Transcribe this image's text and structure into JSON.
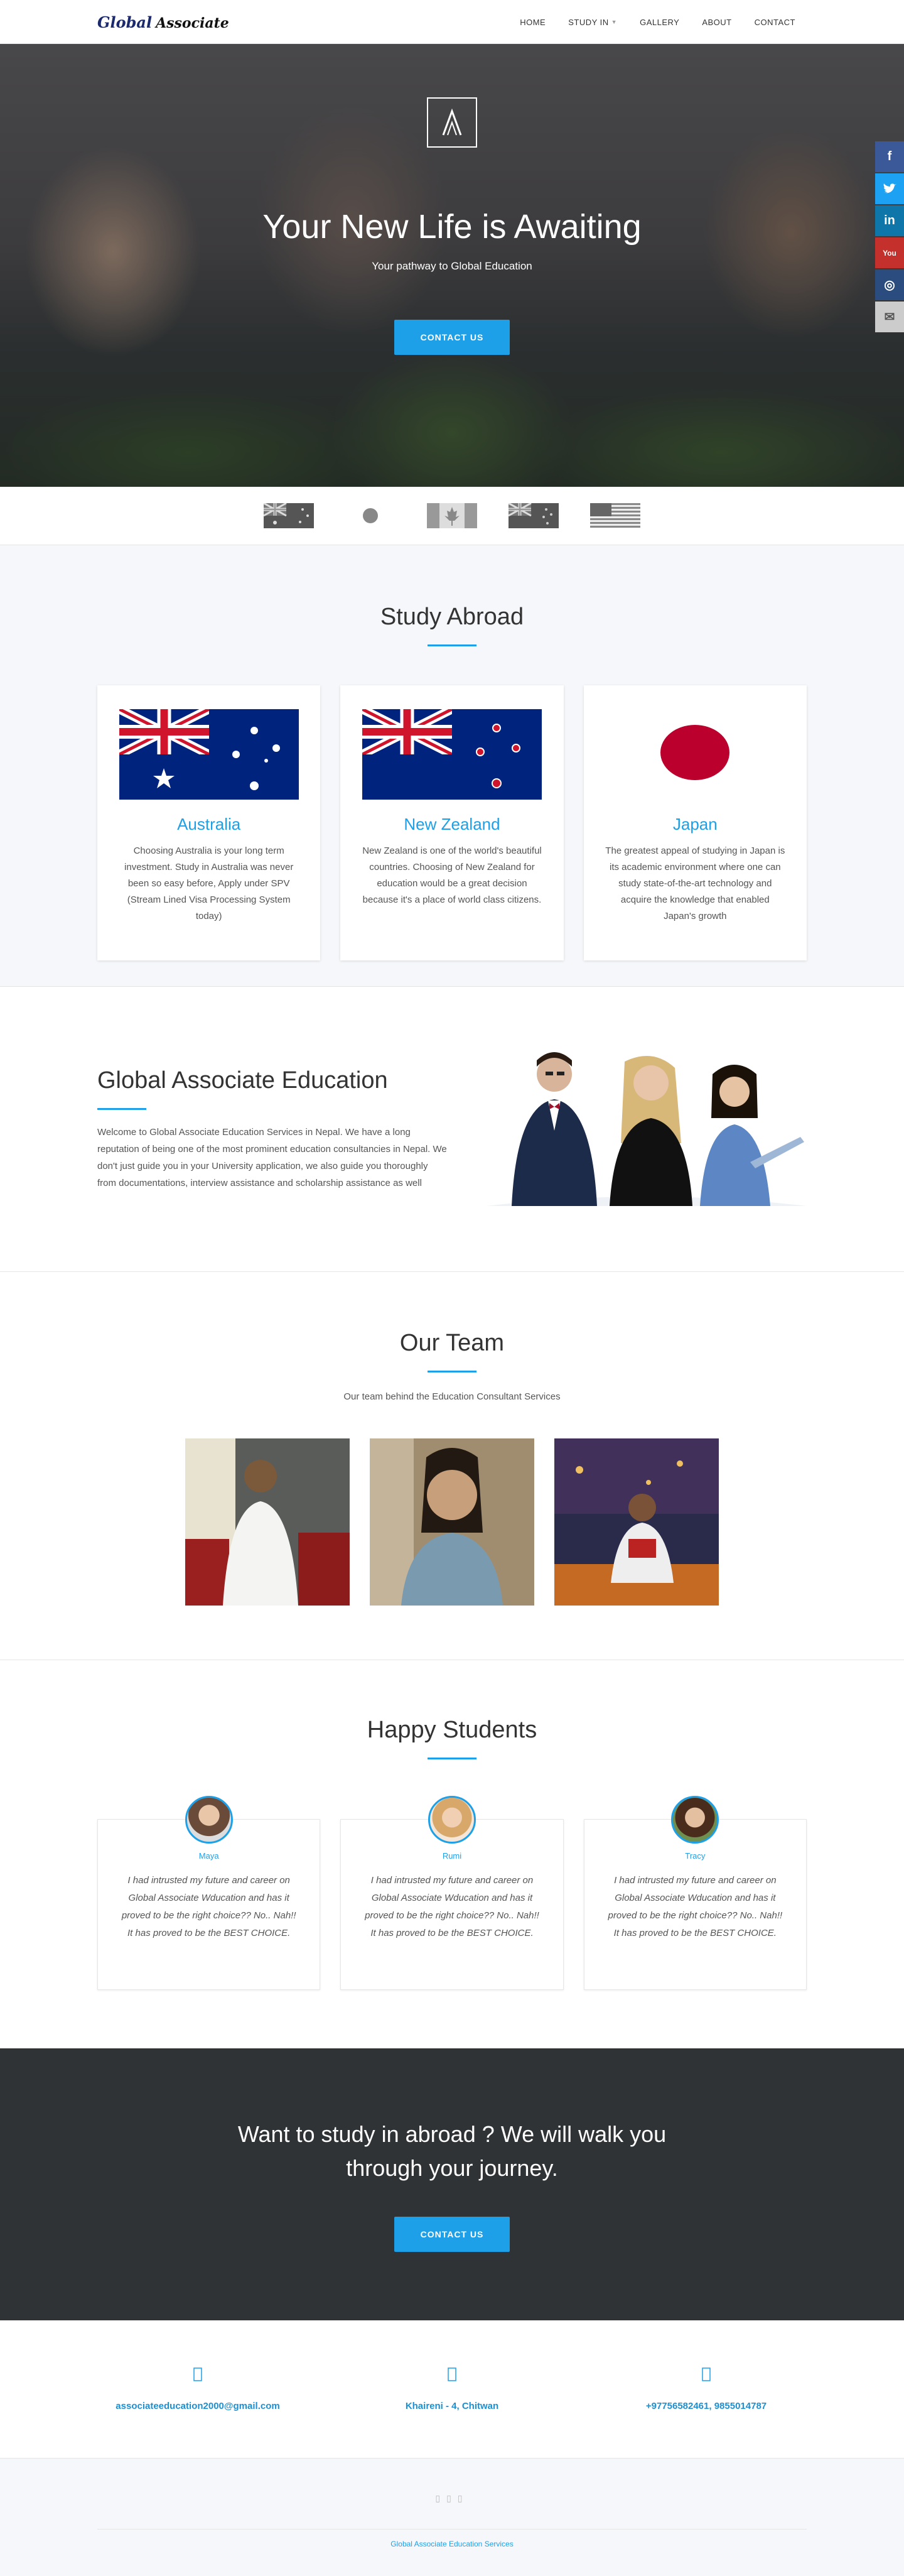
{
  "nav": {
    "logo_primary": "Global",
    "logo_secondary": "Associate",
    "items": [
      {
        "label": "HOME"
      },
      {
        "label": "STUDY IN"
      },
      {
        "label": "GALLERY"
      },
      {
        "label": "ABOUT"
      },
      {
        "label": "CONTACT"
      }
    ]
  },
  "hero": {
    "title": "Your New Life is Awaiting",
    "subtitle": "Your pathway to Global Education",
    "button": "CONTACT US"
  },
  "social": [
    {
      "icon": "facebook-icon",
      "glyph": "f",
      "color": "#3b5998"
    },
    {
      "icon": "twitter-icon",
      "glyph": "t",
      "color": "#1da1f2"
    },
    {
      "icon": "linkedin-icon",
      "glyph": "in",
      "color": "#0e76a8"
    },
    {
      "icon": "youtube-icon",
      "glyph": "You",
      "color": "#c4302b"
    },
    {
      "icon": "instagram-icon",
      "glyph": "◎",
      "color": "#2b4c7e"
    },
    {
      "icon": "email-icon",
      "glyph": "✉",
      "color": "#cccccc"
    }
  ],
  "flag_strip": [
    "australia-flag-icon",
    "japan-flag-icon",
    "canada-flag-icon",
    "new-zealand-flag-icon",
    "usa-flag-icon"
  ],
  "study": {
    "title": "Study Abroad",
    "cards": [
      {
        "title": "Australia",
        "text": "Choosing Australia is your long term investment. Study in Australia was never been so easy before, Apply under SPV (Stream Lined Visa Processing System today)"
      },
      {
        "title": "New Zealand",
        "text": "New Zealand is one of the world's beautiful countries. Choosing of New Zealand for education would be a great decision because it's a place of world class citizens."
      },
      {
        "title": "Japan",
        "text": "The greatest appeal of studying in Japan is its academic environment where one can study state-of-the-art technology and acquire the knowledge that enabled Japan's growth"
      }
    ]
  },
  "about": {
    "title": "Global Associate Education",
    "text": "Welcome to Global Associate Education Services in Nepal. We have a long reputation of being one of the most prominent education consultancies in Nepal. We don't just guide you in your University application, we also guide you thoroughly from documentations, interview assistance and scholarship assistance as well"
  },
  "team": {
    "title": "Our Team",
    "lead": "Our team behind the Education Consultant Services"
  },
  "testimonials": {
    "title": "Happy Students",
    "items": [
      {
        "name": "Maya",
        "quote": "I had intrusted my future and career on Global Associate Wducation and has it proved to be the right choice?? No.. Nah!! It has proved to be the BEST CHOICE."
      },
      {
        "name": "Rumi",
        "quote": "I had intrusted my future and career on Global Associate Wducation and has it proved to be the right choice?? No.. Nah!! It has proved to be the BEST CHOICE."
      },
      {
        "name": "Tracy",
        "quote": "I had intrusted my future and career on Global Associate Wducation and has it proved to be the right choice?? No.. Nah!! It has proved to be the BEST CHOICE."
      }
    ]
  },
  "cta": {
    "title": "Want to study in abroad ? We will walk you through your journey.",
    "button": "CONTACT US"
  },
  "contact": [
    {
      "icon": "envelope-icon",
      "text": "associateeducation2000@gmail.com"
    },
    {
      "icon": "map-marker-icon",
      "text": "Khaireni - 4, Chitwan"
    },
    {
      "icon": "phone-icon",
      "text": "+97756582461, 9855014787"
    }
  ],
  "footer": {
    "copyright": "Global Associate Education Services"
  }
}
